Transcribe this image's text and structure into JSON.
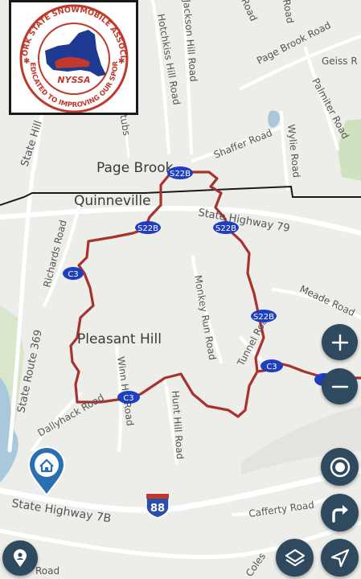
{
  "logo": {
    "ring_top": "NEW YORK STATE SNOWMOBILE ASSOCIATION",
    "ring_bottom": "DEDICATED TO IMPROVING OUR SPORT",
    "abbr": "NYSSA"
  },
  "places": {
    "page_brook": "Page Brook",
    "quinneville": "Quinneville",
    "pleasant_hill": "Pleasant Hill"
  },
  "roads": {
    "state_hill": "State Hill",
    "hotchkiss": "Hotchkiss Hill Road",
    "jackson": "Jackson Hill Road",
    "road_top": "Road",
    "page_brook_road": "Page Brook Road",
    "geiss": "Geiss R",
    "palmiter": "Palmiter Road",
    "wylie": "Wylie Road",
    "shaffer": "Shaffer Road",
    "sh79": "State Highway 79",
    "richards": "Richards Road",
    "sr369": "State Route 369",
    "monkey_run": "Monkey Run Road",
    "meade": "Meade Road",
    "tunnel": "Tunnel Road",
    "winn": "Winn Hill Road",
    "hunt": "Hunt Hill Road",
    "dallyhack": "Dallyhack Road",
    "sh7b": "State Highway 7B",
    "cafferty": "Cafferty Road",
    "coles": "Coles",
    "ma": "Ma",
    "road_bottom": "Road",
    "stubs": "Stubs"
  },
  "shields": {
    "s22b": "S22B",
    "c3": "C3",
    "i88": "88"
  },
  "colors": {
    "trail": "#a8322d",
    "shield": "#1f3fbf",
    "interstate": "#2b4fa8",
    "fab": "#2f4a5e",
    "home_pin": "#2a6fb0",
    "water": "#a9c8dc",
    "park": "#c8dfb4"
  },
  "controls": {
    "zoom_in": "plus-icon",
    "zoom_out": "minus-icon",
    "locate": "target-icon",
    "directions": "turn-right-icon",
    "layers": "layers-icon",
    "navigate": "navigation-arrow-icon",
    "user": "user-pin-icon",
    "home": "home-pin-icon"
  }
}
